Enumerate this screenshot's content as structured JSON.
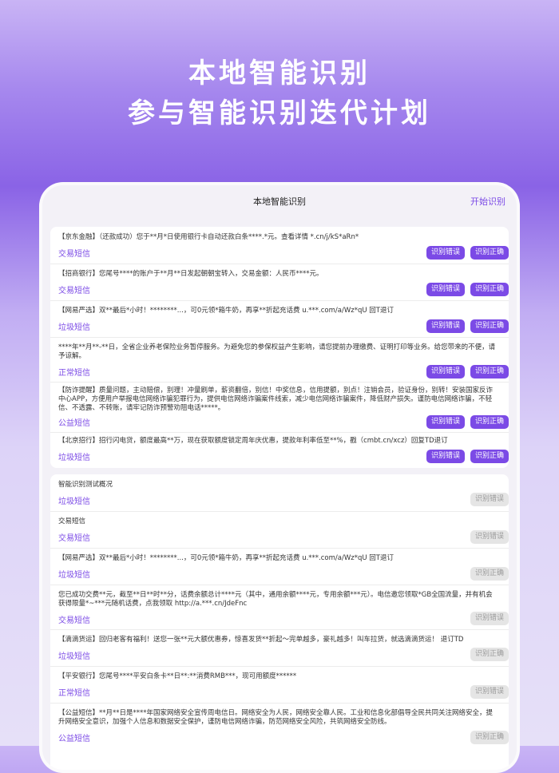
{
  "hero": {
    "line1": "本地智能识别",
    "line2": "参与智能识别迭代计划"
  },
  "navbar": {
    "title": "本地智能识别",
    "action": "开始识别"
  },
  "buttons": {
    "error": "识别错误",
    "correct": "识别正确"
  },
  "pending_messages": [
    {
      "text": "【京东金融】（还款成功）您于**月*日使用银行卡自动还款白条****.*元。查看详情 *.cn/j/kS*aRn*",
      "category": "交易短信"
    },
    {
      "text": "【招商银行】您尾号****的账户于**月**日发起朝朝宝转入，交易金额：人民币****元。",
      "category": "交易短信"
    },
    {
      "text": "【网易严选】双**最后*小时！********...，可0元领*箱牛奶，再享**折起充话费 u.***.com/a/Wz*qU 回T退订",
      "category": "垃圾短信"
    },
    {
      "text": "****年**月**-**日，全省企业养老保险业务暂停服务。为避免您的参保权益产生影响，请您提前办理缴费、证明打印等业务。给您带来的不便，请予谅解。",
      "category": "正常短信"
    },
    {
      "text": "【防诈提醒】质量问题，主动赔偿，别理！冲量刷单，薪资翻倍，别信！中奖信息，信用提额，别点！注销会员，验证身份，别转！安装国家反诈中心APP，方便用户举报电信网络诈骗犯罪行为，提供电信网络诈骗案件线索，减少电信网络诈骗案件，降低财产损失。谨防电信网络诈骗，不轻信、不透露、不转账，请牢记防诈预警劝阻电话*****。",
      "category": "公益短信"
    },
    {
      "text": "【北京招行】招行闪电贷，额度最高**万，现在获取额度锁定周年庆优惠，提款年利率低至**%，戳（cmbt.cn/xcz）回复TD退订",
      "category": "垃圾短信"
    }
  ],
  "test_overview": [
    {
      "text": "智能识别测试概况",
      "category": "垃圾短信",
      "result": "识别错误"
    },
    {
      "text": "交易短信",
      "category": "交易短信",
      "result": "识别错误"
    },
    {
      "text": "【网易严选】双**最后*小时！********...，可0元领*箱牛奶，再享**折起充话费 u.***.com/a/Wz*qU 回T退订",
      "category": "垃圾短信",
      "result": "识别正确"
    },
    {
      "text": "您已成功交费**元，截至**日**时**分，话费余额总计****元（其中，通用余额****元，专用余额***元）。电信邀您领取*GB全国流量，并有机会获得限量*~***元随机话费，点我领取 http://a.***.cn/JdeFnc",
      "category": "交易短信",
      "result": "识别错误"
    },
    {
      "text": "【滴滴货运】回归老客有福利！送您一张**元大额优惠券，惊喜发货**折起～完单越多，豪礼越多！叫车拉货，就选滴滴货运！ 退订TD",
      "category": "垃圾短信",
      "result": "识别正确"
    },
    {
      "text": "【平安银行】您尾号****平安白条卡**日**:**消费RMB***，现可用额度******",
      "category": "正常短信",
      "result": "识别错误"
    },
    {
      "text": "【公益短信】**月**日是****年国家网络安全宣传周电信日。网络安全为人民，网络安全靠人民。工业和信息化部倡导全民共同关注网络安全，提升网络安全意识，加强个人信息和数据安全保护，谨防电信网络诈骗，防范网络安全风险，共筑网络安全防线。",
      "category": "公益短信",
      "result": "识别正确"
    }
  ]
}
